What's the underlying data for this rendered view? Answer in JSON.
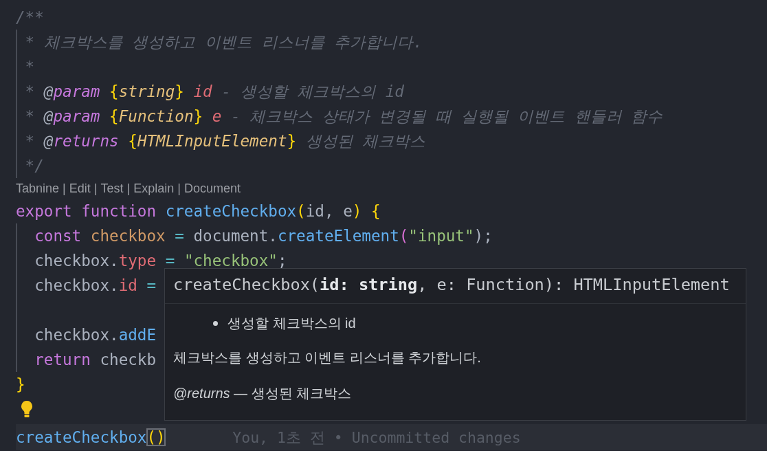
{
  "editor": {
    "lines": [
      {
        "guide": false,
        "tokens": [
          {
            "t": "/**",
            "kind": "comment"
          }
        ]
      },
      {
        "guide": true,
        "tokens": [
          {
            "t": " * 체크박스를 생성하고 이벤트 리스너를 추가합니다.",
            "kind": "comment"
          }
        ]
      },
      {
        "guide": true,
        "tokens": [
          {
            "t": " *",
            "kind": "comment"
          }
        ]
      },
      {
        "guide": true,
        "tokens": [
          {
            "t": " *",
            "kind": "comment"
          },
          {
            "t": " @",
            "kind": "at"
          },
          {
            "t": "param",
            "kind": "tag"
          },
          {
            "t": " {",
            "kind": "brace"
          },
          {
            "t": "string",
            "kind": "type"
          },
          {
            "t": "}",
            "kind": "brace"
          },
          {
            "t": " id",
            "kind": "param"
          },
          {
            "t": " - 생성할 체크박스의 id",
            "kind": "comment"
          }
        ]
      },
      {
        "guide": true,
        "tokens": [
          {
            "t": " *",
            "kind": "comment"
          },
          {
            "t": " @",
            "kind": "at"
          },
          {
            "t": "param",
            "kind": "tag"
          },
          {
            "t": " {",
            "kind": "brace"
          },
          {
            "t": "Function",
            "kind": "type"
          },
          {
            "t": "}",
            "kind": "brace"
          },
          {
            "t": " e",
            "kind": "param"
          },
          {
            "t": " - 체크박스 상태가 변경될 때 실행될 이벤트 핸들러 함수",
            "kind": "comment"
          }
        ]
      },
      {
        "guide": true,
        "tokens": [
          {
            "t": " *",
            "kind": "comment"
          },
          {
            "t": " @",
            "kind": "at"
          },
          {
            "t": "returns",
            "kind": "tag"
          },
          {
            "t": " {",
            "kind": "brace"
          },
          {
            "t": "HTMLInputElement",
            "kind": "type"
          },
          {
            "t": "}",
            "kind": "brace"
          },
          {
            "t": " 생성된 체크박스",
            "kind": "comment"
          }
        ]
      },
      {
        "guide": true,
        "tokens": [
          {
            "t": " */",
            "kind": "comment"
          }
        ]
      }
    ],
    "codelens": {
      "items": [
        "Tabnine",
        "Edit",
        "Test",
        "Explain",
        "Document"
      ],
      "separator": "|"
    },
    "lines_after": [
      {
        "guide": false,
        "tokens": [
          {
            "t": "export",
            "kind": "keyword"
          },
          {
            "t": " function",
            "kind": "keyword"
          },
          {
            "t": " createCheckbox",
            "kind": "function"
          },
          {
            "t": "(",
            "kind": "brace"
          },
          {
            "t": "id, e",
            "kind": "plain"
          },
          {
            "t": ")",
            "kind": "brace"
          },
          {
            "t": " {",
            "kind": "brace"
          }
        ]
      },
      {
        "guide": true,
        "tokens": [
          {
            "t": "  const",
            "kind": "keyword"
          },
          {
            "t": " checkbox",
            "kind": "variable"
          },
          {
            "t": " = ",
            "kind": "operator"
          },
          {
            "t": "document.",
            "kind": "plain"
          },
          {
            "t": "createElement",
            "kind": "function"
          },
          {
            "t": "(",
            "kind": "paren"
          },
          {
            "t": "\"input\"",
            "kind": "string"
          },
          {
            "t": ");",
            "kind": "plain"
          }
        ]
      },
      {
        "guide": true,
        "tokens": [
          {
            "t": "  checkbox.",
            "kind": "plain"
          },
          {
            "t": "type",
            "kind": "property"
          },
          {
            "t": " = ",
            "kind": "operator"
          },
          {
            "t": "\"checkbox\"",
            "kind": "string"
          },
          {
            "t": ";",
            "kind": "plain"
          }
        ]
      },
      {
        "guide": true,
        "tokens": [
          {
            "t": "  checkbox.",
            "kind": "plain"
          },
          {
            "t": "id",
            "kind": "property"
          },
          {
            "t": " =",
            "kind": "operator"
          }
        ]
      },
      {
        "guide": true
      },
      {
        "guide": true,
        "tokens": [
          {
            "t": "  checkbox.",
            "kind": "plain"
          },
          {
            "t": "addE",
            "kind": "function"
          }
        ]
      },
      {
        "guide": true,
        "tokens": [
          {
            "t": "  return",
            "kind": "keyword"
          },
          {
            "t": " checkb",
            "kind": "plain"
          }
        ]
      },
      {
        "guide": false,
        "tokens": [
          {
            "t": "}",
            "kind": "brace"
          }
        ]
      }
    ],
    "lightbulb": true,
    "current_line": {
      "tokens": [
        {
          "t": "createCheckbox",
          "kind": "function"
        },
        {
          "t": "()",
          "kind": "match"
        }
      ],
      "blame": "You, 1초 전 • Uncommitted changes"
    }
  },
  "hover": {
    "signature": "createCheckbox(**id: string**, e: Function): HTMLInputElement",
    "bullets": [
      "생성할 체크박스의 id"
    ],
    "description": "체크박스를 생성하고 이벤트 리스너를 추가합니다.",
    "returns": "*@returns* — 생성된 체크박스"
  }
}
